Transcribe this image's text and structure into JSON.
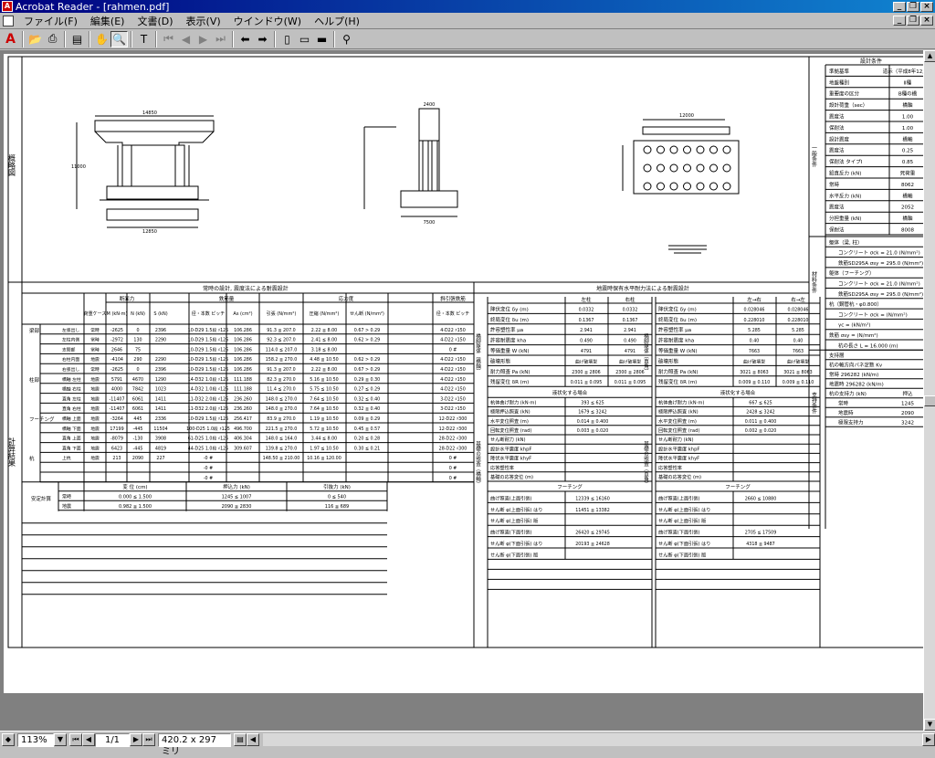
{
  "window": {
    "title": "Acrobat Reader - [rahmen.pdf]"
  },
  "menu": [
    "ファイル(F)",
    "編集(E)",
    "文書(D)",
    "表示(V)",
    "ウインドウ(W)",
    "ヘルプ(H)"
  ],
  "status": {
    "zoom": "113%",
    "page": "1/1",
    "size": "420.2 x 297 ミリ"
  },
  "sections": {
    "outline_label": "概略図",
    "conditions_title": "設計条件",
    "normal_design_title": "常時の設計, 震度法による耐震設計",
    "seismic_title": "地震時保有水平耐力法による耐震設計",
    "calc_results_label": "計算結果",
    "materials_label": "材料条件",
    "general_label": "一般条件",
    "support_label": "支持条件"
  },
  "conditions": [
    [
      "準拠基準",
      "道示（平成8年12月）"
    ],
    [
      "地盤種別",
      "Ⅱ種"
    ],
    [
      "重要度の区分",
      "B種の橋"
    ],
    [
      "設計荷重（sec）",
      "橋軸"
    ],
    [
      "震度法",
      "1.00"
    ],
    [
      "保耐法",
      "1.00"
    ],
    [
      "設計震度",
      "橋軸"
    ],
    [
      "震度法",
      "0.25"
    ],
    [
      "保耐法 タイプⅠ",
      "0.85"
    ],
    [
      "鉛直反力 (kN)",
      "死荷重"
    ],
    [
      "常時",
      "8062"
    ],
    [
      "水平反力 (kN)",
      "橋軸"
    ],
    [
      "震度法",
      "2052"
    ],
    [
      "分担重量 (kN)",
      "橋軸"
    ],
    [
      "保耐法",
      "8008"
    ]
  ],
  "materials": [
    "躯体（梁, 柱）",
    "コンクリート σck = 21.0 (N/mm²)",
    "鉄筋SD295A σsy = 295.0 (N/mm²)",
    "躯体（フーチング）",
    "コンクリート σck = 21.0 (N/mm²)",
    "鉄筋SD295A σsy = 295.0 (N/mm²)",
    "杭（鋼管杭・φ0.800）",
    "コンクリート σck = (N/mm²)",
    "γc = (kN/m³)",
    "鉄筋 σsy = (N/mm²)",
    "杭の長さ L = 16.000 (m)"
  ],
  "support": [
    [
      "支持層",
      ""
    ],
    [
      "杭の軸方向バネ定数 Kv",
      ""
    ],
    [
      "常時 296282 (kN/m)",
      ""
    ],
    [
      "地震時 296282 (kN/m)",
      ""
    ],
    [
      "杭の支持力 (kN)",
      "押込"
    ],
    [
      "常時",
      "1245"
    ],
    [
      "地震時",
      "2090"
    ],
    [
      "極限支持力",
      "3242"
    ]
  ],
  "normal_table": {
    "headers": [
      "荷重ケース",
      "M (kN·m)",
      "N (kN)",
      "S (kN)",
      "径・本数 ピッチ",
      "As (cm²)",
      "引張 (N/mm²)",
      "圧縮 (N/mm²)",
      "せん断 (N/mm²)",
      "径・本数 ピッチ"
    ],
    "group_headers": [
      "断面力",
      "鉄筋量",
      "応力度",
      "斜引張鉄筋"
    ],
    "rows": [
      [
        "梁部",
        "左張出し",
        "常時",
        "-2625",
        "0",
        "2396",
        "10-D29 1.5段 ♯125",
        "106.286",
        "91.3 ≦ 207.0",
        "2.22 ≦ 8.00",
        "0.67 > 0.29",
        "4-D22 ♯150"
      ],
      [
        "梁部",
        "左柱内側",
        "常時",
        "-2972",
        "130",
        "2290",
        "10-D29 1.5段 ♯125",
        "106.286",
        "92.3 ≦ 207.0",
        "2.41 ≦ 8.00",
        "0.62 > 0.29",
        "4-D22 ♯150"
      ],
      [
        "梁部",
        "支間部",
        "常時",
        "2646",
        "75",
        "",
        "10-D29 1.5段 ♯125",
        "106.286",
        "114.0 ≦ 207.0",
        "3.18 ≦ 8.00",
        "",
        "0 #"
      ],
      [
        "梁部",
        "右柱内面",
        "地震",
        "-4104",
        "290",
        "2290",
        "10-D29 1.5段 ♯125",
        "106.286",
        "158.2 ≦ 270.0",
        "4.48 ≦ 10.50",
        "0.62 > 0.29",
        "4-D22 ♯150"
      ],
      [
        "梁部",
        "右張出し",
        "常時",
        "-2625",
        "0",
        "2396",
        "10-D29 1.5段 ♯125",
        "106.286",
        "91.3 ≦ 207.0",
        "2.22 ≦ 8.00",
        "0.67 > 0.29",
        "4-D22 ♯150"
      ],
      [
        "柱部",
        "橋軸 左柱",
        "地震",
        "5791",
        "4670",
        "1290",
        "14-D32 1.0段 ♯125",
        "111.188",
        "82.3 ≦ 270.0",
        "5.16 ≦ 10.50",
        "0.29 ≦ 0.30",
        "4-D22 ♯150"
      ],
      [
        "柱部",
        "橋軸 右柱",
        "地震",
        "4000",
        "7842",
        "1023",
        "14-D32 1.0段 ♯125",
        "111.188",
        "11.4 ≦ 270.0",
        "5.75 ≦ 10.50",
        "0.27 ≦ 0.29",
        "4-D22 ♯150"
      ],
      [
        "柱部",
        "直角 左柱",
        "地震",
        "-11407",
        "6061",
        "1411",
        "11-D32 2.0段 ♯125",
        "236.260",
        "148.0 ≦ 270.0",
        "7.64 ≦ 10.50",
        "0.32 ≦ 0.40",
        "3-D22 ♯150"
      ],
      [
        "柱部",
        "直角 右柱",
        "地震",
        "-11407",
        "6061",
        "1411",
        "11-D32 2.0段 ♯125",
        "236.260",
        "148.0 ≦ 270.0",
        "7.64 ≦ 10.50",
        "0.32 ≦ 0.40",
        "3-D22 ♯150"
      ],
      [
        "フーチング",
        "橋軸 上面",
        "地震",
        "-3264",
        "445",
        "2336",
        "10-D29 1.5段 ♯125",
        "256.417",
        "83.9 ≦ 270.0",
        "1.19 ≦ 10.50",
        "0.09 ≦ 0.29",
        "12-D22 ♯300"
      ],
      [
        "フーチング",
        "橋軸 下面",
        "地震",
        "17199",
        "-445",
        "11504",
        "100-D25 1.0段 ♯125",
        "496.700",
        "221.5 ≦ 270.0",
        "5.72 ≦ 10.50",
        "0.45 ≦ 0.57",
        "12-D22 ♯300"
      ],
      [
        "フーチング",
        "直角 上面",
        "地震",
        "-8079",
        "-130",
        "3908",
        "61-D25 1.0段 ♯125",
        "406.304",
        "148.0 ≦ 164.0",
        "3.44 ≦ 8.00",
        "0.20 ≦ 0.28",
        "28-D22 ♯300"
      ],
      [
        "フーチング",
        "直角 下面",
        "地震",
        "6423",
        "-445",
        "4819",
        "44-D25 1.0段 ♯125",
        "309.607",
        "139.8 ≦ 270.0",
        "1.97 ≦ 10.50",
        "0.30 ≦ 0.21",
        "28-D22 ♯300"
      ],
      [
        "杭",
        "上杭",
        "地震",
        "213",
        "2090",
        "227",
        "-0 #",
        "",
        "148.50 ≦ 210.00",
        "10.16 ≦ 120.00",
        "",
        "0 #"
      ],
      [
        "杭",
        "",
        "",
        "",
        "",
        "",
        "-0 #",
        "",
        "",
        "",
        "",
        "0 #"
      ],
      [
        "杭",
        "",
        "",
        "",
        "",
        "",
        "-0 #",
        "",
        "",
        "",
        "",
        "0 #"
      ]
    ]
  },
  "stability": {
    "label": "安定計算",
    "headers": [
      "変 位 (cm)",
      "押込力 (kN)",
      "引抜力 (kN)"
    ],
    "rows": [
      [
        "常時",
        "0.000 ≦ 1.500",
        "1245 ≦ 1007",
        "0 ≦ 540"
      ],
      [
        "地震",
        "0.982 ≦ 1.500",
        "2090 ≦ 2830",
        "116 ≦ 689"
      ]
    ]
  },
  "seismic_left": {
    "label": "橋脚躯体（橋軸）",
    "headers": [
      "左柱",
      "右柱"
    ],
    "rows": [
      [
        "降伏変位 δy (m)",
        "0.0332",
        "0.0332"
      ],
      [
        "終局変位 δu (m)",
        "0.1367",
        "0.1367"
      ],
      [
        "許容塑性率 μa",
        "2.941",
        "2.941"
      ],
      [
        "許容耐震度 kha",
        "0.490",
        "0.490"
      ],
      [
        "等価重量 W (kN)",
        "4791",
        "4791"
      ],
      [
        "破壊形態",
        "曲げ破壊型",
        "曲げ破壊型"
      ],
      [
        "耐力照査 Pa (kN)",
        "2300 ≦ 2806",
        "2300 ≦ 2806"
      ],
      [
        "残留変位 δR (m)",
        "0.011 ≦ 0.095",
        "0.011 ≦ 0.095"
      ]
    ],
    "sub_title": "液状化する場合",
    "sub_rows": [
      [
        "杭体曲げ耐力 (kN·m)",
        "393 ≦ 625"
      ],
      [
        "極限押込照査 (kN)",
        "1679 ≦ 3242"
      ],
      [
        "水平変位照査 (m)",
        "0.014 ≦ 0.400"
      ],
      [
        "回転変位照査 (rad)",
        "0.003 ≦ 0.020"
      ],
      [
        "せん断耐力 (kN)",
        ""
      ],
      [
        "設計水平震度 khpF",
        ""
      ],
      [
        "降伏水平震度 khyF",
        ""
      ],
      [
        "応答塑性率",
        ""
      ],
      [
        "基礎の応答変位 (m)",
        ""
      ]
    ],
    "found_label": "基礎の照査（橋軸）",
    "footing_title": "フーチング",
    "footing_rows": [
      [
        "曲げ照査(上面引張)",
        "12339 ≦ 16160"
      ],
      [
        "せん断 φ(上面引張) はり",
        "11451 ≦ 13382"
      ],
      [
        "せん断 φ(上面引張) 版",
        ""
      ],
      [
        "曲げ照査(下面引張)",
        "26420 ≦ 29745"
      ],
      [
        "せん断 φ(下面引張) はり",
        "20193 ≦ 24628"
      ],
      [
        "せん断 φ(下面引張) 版",
        ""
      ]
    ]
  },
  "seismic_right": {
    "label": "橋脚躯体（直角）",
    "headers": [
      "左→右",
      "右→左"
    ],
    "rows": [
      [
        "降伏変位 δy (m)",
        "0.028046",
        "0.028046"
      ],
      [
        "終局変位 δu (m)",
        "0.228010",
        "0.228010"
      ],
      [
        "許容塑性率 μa",
        "5.285",
        "5.285"
      ],
      [
        "許容耐震度 kha",
        "0.40",
        "0.40"
      ],
      [
        "等価重量 W (kN)",
        "7663",
        "7663"
      ],
      [
        "破壊形態",
        "曲げ破壊型",
        "曲げ破壊型"
      ],
      [
        "耐力照査 Pa (kN)",
        "3021 ≦ 8063",
        "3021 ≦ 8063"
      ],
      [
        "残留変位 δR (m)",
        "0.009 ≦ 0.110",
        "0.009 ≦ 0.110"
      ]
    ],
    "sub_title": "液状化する場合",
    "sub_rows": [
      [
        "杭体曲げ耐力 (kN·m)",
        "667 ≦ 625"
      ],
      [
        "極限押込照査 (kN)",
        "2428 ≦ 3242"
      ],
      [
        "水平変位照査 (m)",
        "0.011 ≦ 0.400"
      ],
      [
        "回転変位照査 (rad)",
        "0.002 ≦ 0.020"
      ],
      [
        "せん断耐力 (kN)",
        ""
      ],
      [
        "設計水平震度 khpF",
        ""
      ],
      [
        "降伏水平震度 khyF",
        ""
      ],
      [
        "応答塑性率",
        ""
      ],
      [
        "基礎の応答変位 (m)",
        ""
      ]
    ],
    "found_label": "基礎の照査（直角）",
    "footing_title": "フーチング",
    "footing_rows": [
      [
        "曲げ照査(上面引張)",
        "2660 ≦ 10880"
      ],
      [
        "せん断 φ(上面引張) はり",
        ""
      ],
      [
        "せん断 φ(上面引張) 版",
        ""
      ],
      [
        "曲げ照査(下面引張)",
        "2705 ≦ 17509"
      ],
      [
        "せん断 φ(下面引張) はり",
        "4318 ≦ 9487"
      ],
      [
        "せん断 φ(下面引張) 版",
        ""
      ]
    ]
  },
  "drawing_dims": {
    "front_top": "14850",
    "front_bottom": "12850",
    "front_height": "11000",
    "side_top": "2400",
    "side_bottom": "7500",
    "plan_top": "12000"
  }
}
